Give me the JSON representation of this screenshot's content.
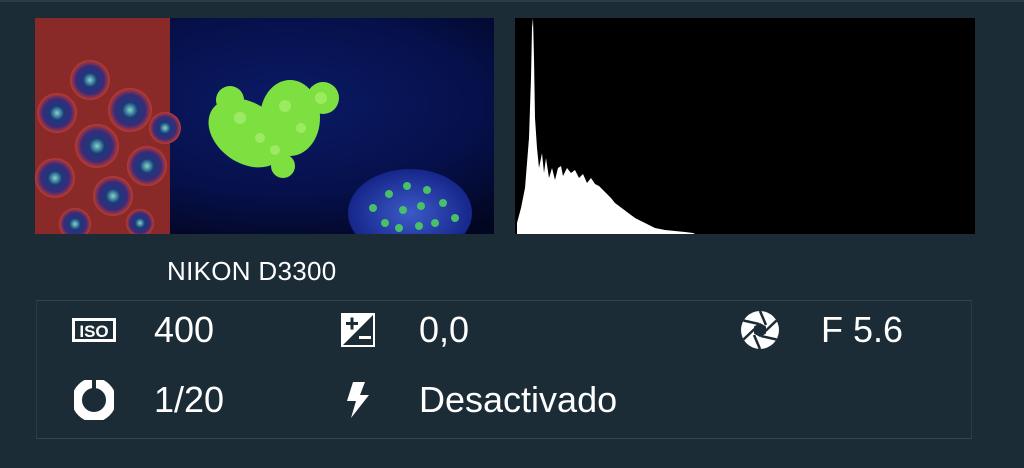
{
  "camera_model": "NIKON D3300",
  "exif": {
    "iso": {
      "icon": "iso-icon",
      "value": "400"
    },
    "exposure_compensation": {
      "icon": "exposure-compensation-icon",
      "value": "0,0"
    },
    "aperture": {
      "icon": "aperture-icon",
      "value": "F 5.6"
    },
    "shutter_speed": {
      "icon": "shutter-speed-icon",
      "value": "1/20"
    },
    "flash": {
      "icon": "flash-icon",
      "value": "Desactivado"
    }
  }
}
